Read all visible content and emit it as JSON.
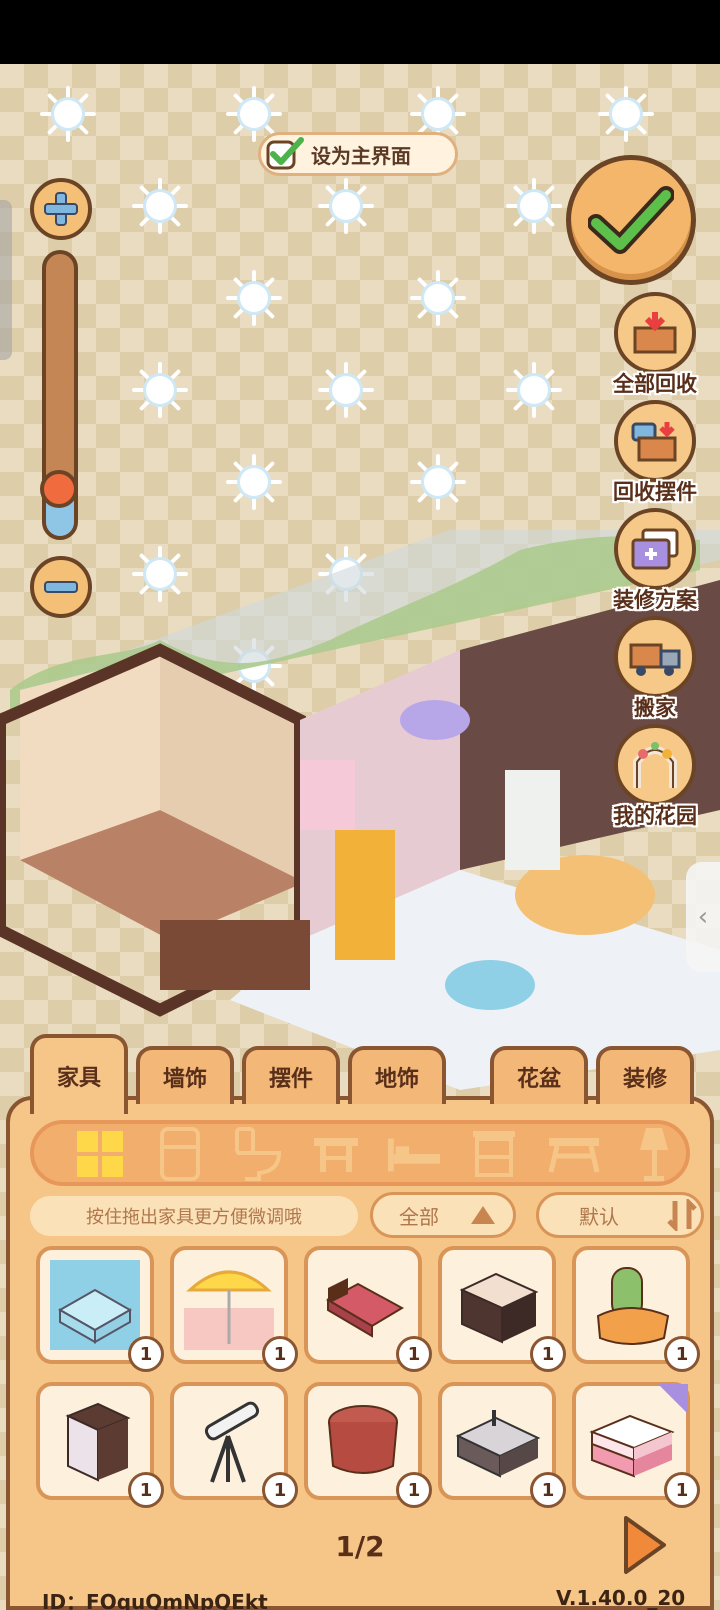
{
  "top_bar": {
    "set_home_label": "设为主界面"
  },
  "zoom": {
    "level": 0.18
  },
  "side_menu": {
    "items": [
      {
        "label": "全部回收",
        "icon": "recycle-all-box-icon"
      },
      {
        "label": "回收摆件",
        "icon": "recycle-ornament-icon"
      },
      {
        "label": "装修方案",
        "icon": "decor-plan-icon"
      },
      {
        "label": "搬家",
        "icon": "moving-truck-icon"
      },
      {
        "label": "我的花园",
        "icon": "garden-arch-icon"
      }
    ]
  },
  "tabs": [
    {
      "label": "家具",
      "active": true
    },
    {
      "label": "墙饰",
      "active": false
    },
    {
      "label": "摆件",
      "active": false
    },
    {
      "label": "地饰",
      "active": false
    },
    {
      "label": "花盆",
      "active": false
    },
    {
      "label": "装修",
      "active": false
    }
  ],
  "categories": [
    {
      "icon": "grid-all-icon",
      "active": true
    },
    {
      "icon": "fridge-icon",
      "active": false
    },
    {
      "icon": "toilet-icon",
      "active": false
    },
    {
      "icon": "stool-icon",
      "active": false
    },
    {
      "icon": "bed-icon",
      "active": false
    },
    {
      "icon": "cabinet-icon",
      "active": false
    },
    {
      "icon": "table-icon",
      "active": false
    },
    {
      "icon": "lamp-icon",
      "active": false
    }
  ],
  "filter": {
    "hint": "按住拖出家具更方便微调哦",
    "category_label": "全部",
    "sort_label": "默认"
  },
  "items": [
    {
      "name": "glass-corner-aquarium",
      "count": "1"
    },
    {
      "name": "lemon-parasol",
      "count": "1"
    },
    {
      "name": "red-bed",
      "count": "1"
    },
    {
      "name": "dark-dresser",
      "count": "1"
    },
    {
      "name": "cactus-armchair",
      "count": "1"
    },
    {
      "name": "nightstand-drawers",
      "count": "1"
    },
    {
      "name": "telescope",
      "count": "1"
    },
    {
      "name": "round-tablecloth-table",
      "count": "1"
    },
    {
      "name": "bathroom-sink-cabinet",
      "count": "1"
    },
    {
      "name": "pink-cushion-block",
      "count": "1",
      "new": true
    }
  ],
  "pager": {
    "page": "1/2"
  },
  "footer": {
    "player_id": "ID：FOquQmNpQEkt",
    "version": "V.1.40.0_20"
  }
}
